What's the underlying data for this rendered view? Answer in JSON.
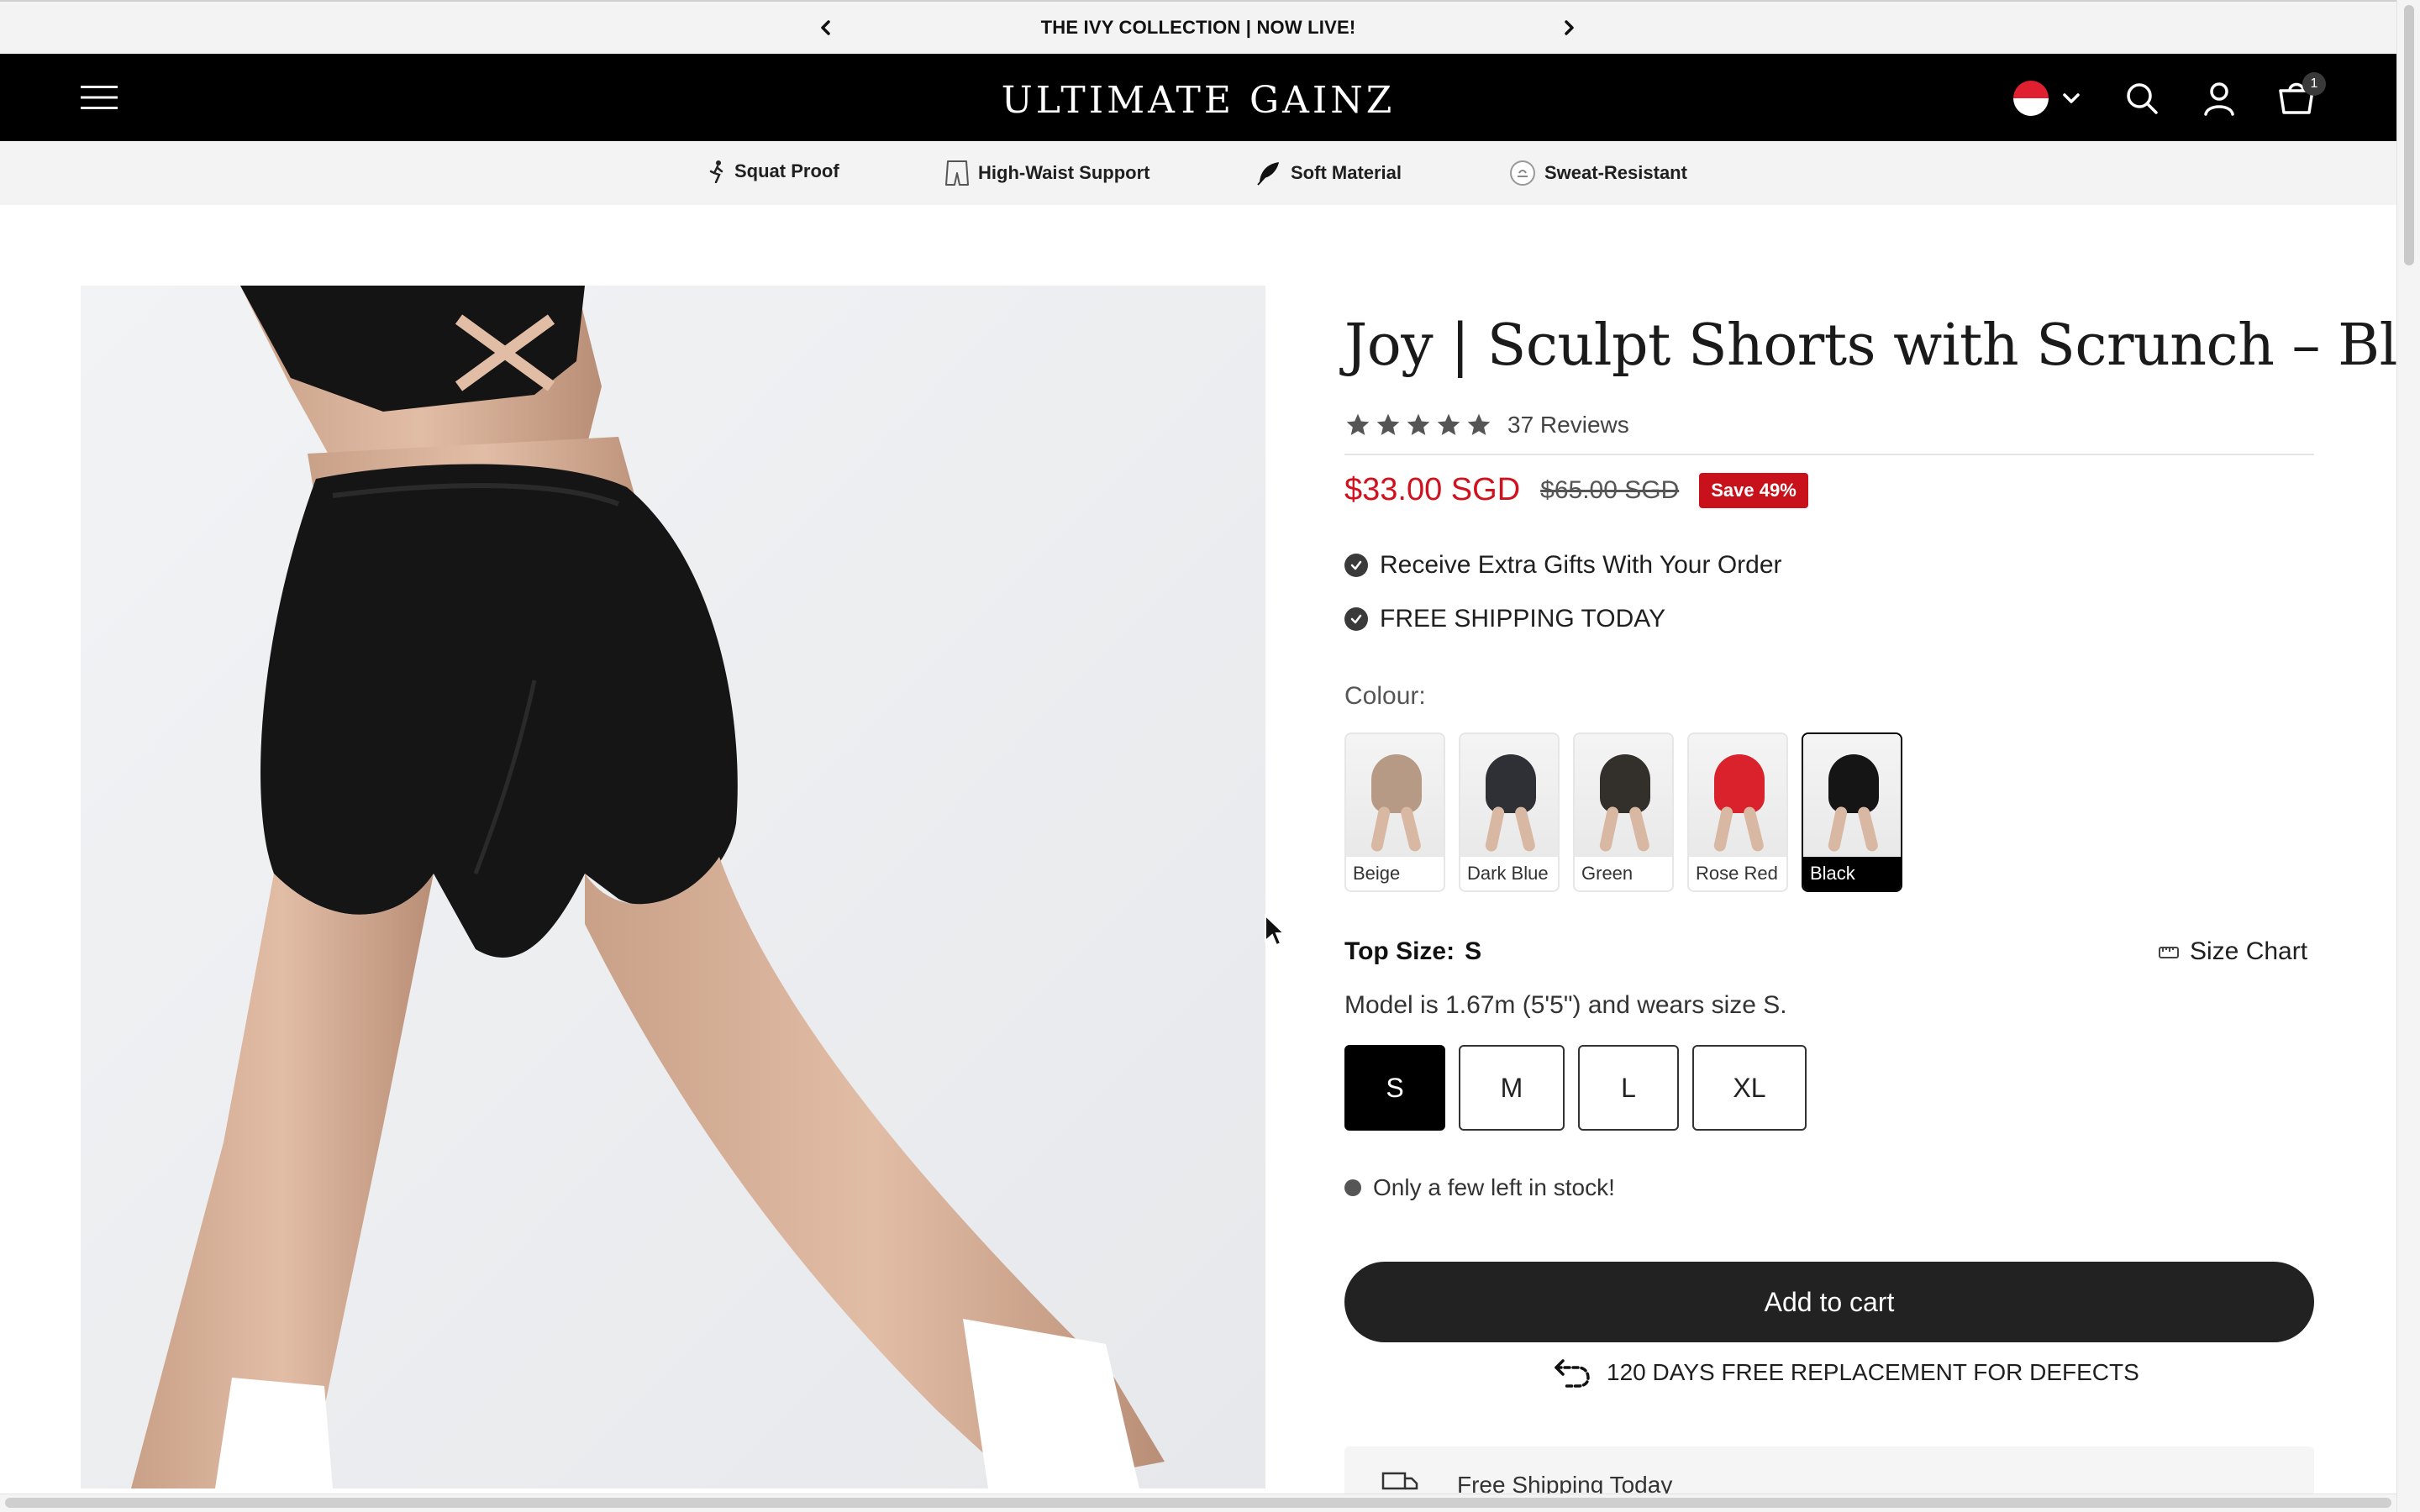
{
  "announcement": {
    "text": "THE IVY COLLECTION | NOW LIVE!"
  },
  "header": {
    "logo": "ULTIMATE GAINZ",
    "cart_count": "1"
  },
  "features": [
    {
      "label": "Squat Proof",
      "icon": "running-figure-icon"
    },
    {
      "label": "High-Waist Support",
      "icon": "shorts-icon"
    },
    {
      "label": "Soft Material",
      "icon": "feather-icon"
    },
    {
      "label": "Sweat-Resistant",
      "icon": "droplet-badge-icon"
    }
  ],
  "product": {
    "title": "Joy | Sculpt Shorts with Scrunch – Black",
    "rating": 5,
    "reviews": "37 Reviews",
    "price": "$33.00 SGD",
    "compare_price": "$65.00 SGD",
    "save_badge": "Save 49%",
    "perks": [
      "Receive Extra Gifts With Your Order",
      "FREE SHIPPING TODAY"
    ],
    "colour_label": "Colour:",
    "colours": [
      {
        "name": "Beige",
        "hex": "#b79a86"
      },
      {
        "name": "Dark Blue",
        "hex": "#2e3036"
      },
      {
        "name": "Green",
        "hex": "#33302c"
      },
      {
        "name": "Rose Red",
        "hex": "#d9222c"
      },
      {
        "name": "Black",
        "hex": "#151515"
      }
    ],
    "selected_colour": "Black",
    "size_label": "Top Size:",
    "size_value": "S",
    "size_chart_label": "Size Chart",
    "model_note": "Model is 1.67m (5'5\") and wears size S.",
    "sizes": [
      "S",
      "M",
      "L",
      "XL"
    ],
    "selected_size": "S",
    "stock_note": "Only a few left in stock!",
    "add_to_cart": "Add to cart",
    "replacement_note": "120 DAYS FREE REPLACEMENT FOR DEFECTS",
    "shipping_card": "Free Shipping Today"
  },
  "colors": {
    "sale_red": "#d0121f",
    "badge_red": "#c8111a",
    "header_bg": "#000000",
    "button_bg": "#222222"
  }
}
